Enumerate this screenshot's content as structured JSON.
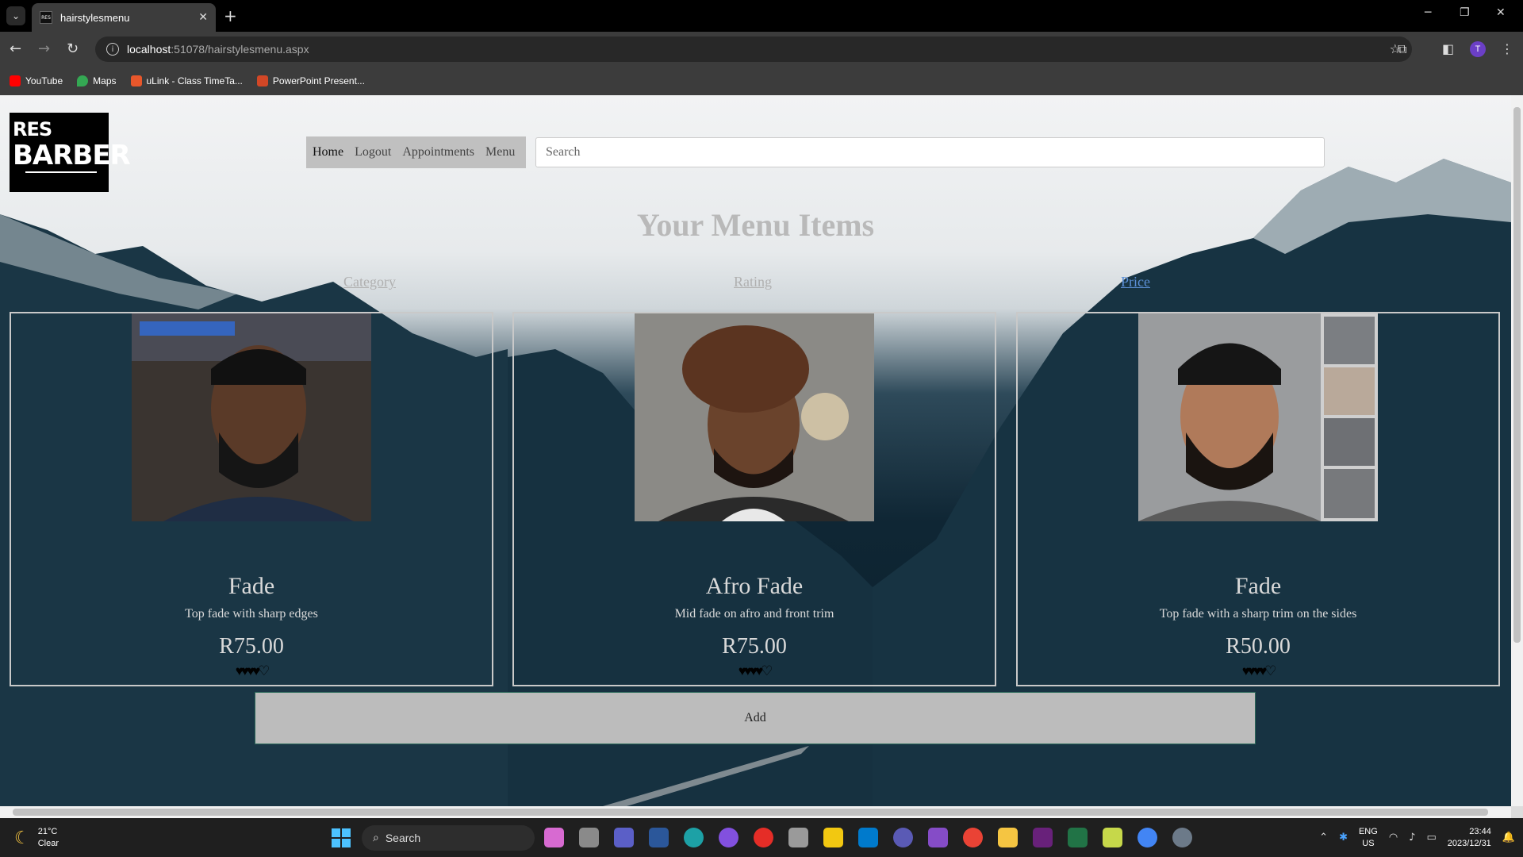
{
  "browser": {
    "tab_title": "hairstylesmenu",
    "url_host": "localhost",
    "url_rest": ":51078/hairstylesmenu.aspx",
    "avatar_letter": "T",
    "bookmarks": [
      {
        "label": "YouTube",
        "color": "#ff0000"
      },
      {
        "label": "Maps",
        "color": "#34a853"
      },
      {
        "label": "uLink - Class TimeTa...",
        "color": "#e8572b"
      },
      {
        "label": "PowerPoint Present...",
        "color": "#d24726"
      }
    ]
  },
  "logo": {
    "line1": "RES",
    "line2": "BARBER"
  },
  "nav": {
    "home": "Home",
    "logout": "Logout",
    "appointments": "Appointments",
    "menu": "Menu"
  },
  "search": {
    "placeholder": "Search"
  },
  "page": {
    "title": "Your Menu Items",
    "sort_category": "Category",
    "sort_rating": "Rating",
    "sort_price": "Price",
    "add_label": "Add"
  },
  "cards": [
    {
      "name": "Fade",
      "description": "Top fade with sharp edges",
      "price": "R75.00",
      "rating_hearts": "♥♥♥♥♡",
      "rating": 4
    },
    {
      "name": "Afro Fade",
      "description": "Mid fade on afro and front trim",
      "price": "R75.00",
      "rating_hearts": "♥♥♥♥♡",
      "rating": 4
    },
    {
      "name": "Fade",
      "description": "Top fade with a sharp trim on the sides",
      "price": "R50.00",
      "rating_hearts": "♥♥♥♥♡",
      "rating": 4
    }
  ],
  "taskbar": {
    "temperature": "21°C",
    "condition": "Clear",
    "search_label": "Search",
    "lang1": "ENG",
    "lang2": "US",
    "time": "23:44",
    "date": "2023/12/31"
  },
  "colors": {
    "link_gray": "#b0b0b0",
    "link_blue": "#5b8fd6",
    "card_border": "#c9c9c9",
    "button_bg": "#bcbcbc"
  }
}
